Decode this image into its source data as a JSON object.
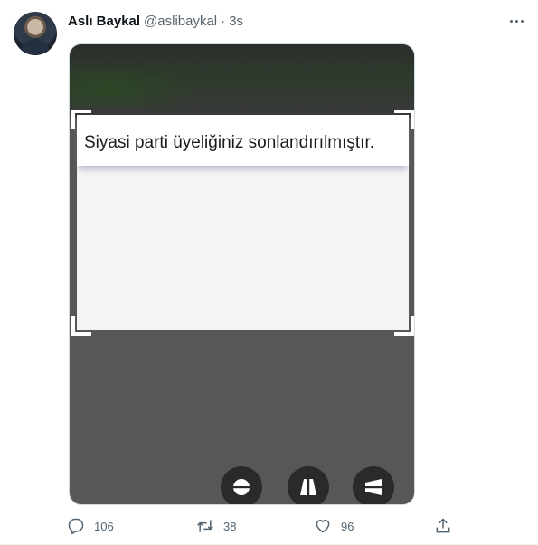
{
  "tweet": {
    "author_name": "Aslı Baykal",
    "handle": "@aslibaykal",
    "separator": "·",
    "time": "3s",
    "more_icon": "more-horizontal-icon",
    "avatar_icon": "profile-photo"
  },
  "media": {
    "message": "Siyasi parti üyeliğiniz sonlandırılmıştır.",
    "tools": [
      {
        "name": "crop-free-tool",
        "icon": "horizontal-flip-icon"
      },
      {
        "name": "crop-vertical-tool",
        "icon": "vertical-perspective-icon"
      },
      {
        "name": "crop-horizontal-tool",
        "icon": "horizontal-perspective-icon"
      }
    ]
  },
  "actions": {
    "reply_count": "106",
    "retweet_count": "38",
    "like_count": "96",
    "icons": [
      "reply-icon",
      "retweet-icon",
      "like-icon",
      "share-icon"
    ]
  },
  "colors": {
    "text_primary": "#0f1419",
    "text_secondary": "#536471",
    "media_bg": "#575757",
    "tool_bg": "#2a2a2a"
  }
}
